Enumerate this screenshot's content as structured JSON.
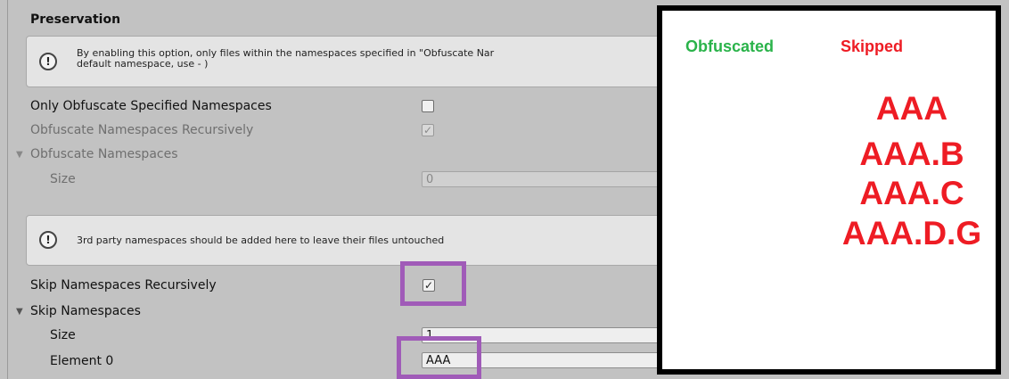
{
  "section_title": "Preservation",
  "help_top": {
    "line1": "By enabling this option, only files within the namespaces specified in \"Obfuscate Nar",
    "line2": "default namespace, use - )"
  },
  "only_obfuscate": {
    "label": "Only Obfuscate Specified Namespaces",
    "checked": false
  },
  "obfuscate_recursive": {
    "label": "Obfuscate Namespaces Recursively",
    "checked": true,
    "check_glyph": "✓"
  },
  "obfuscate_namespaces": {
    "label": "Obfuscate Namespaces",
    "size_label": "Size",
    "size_value": "0"
  },
  "help_bottom": {
    "text": "3rd party namespaces should be added here to leave their files untouched"
  },
  "skip_recursive": {
    "label": "Skip Namespaces Recursively",
    "checked": true,
    "check_glyph": "✓"
  },
  "skip_namespaces": {
    "label": "Skip Namespaces",
    "size_label": "Size",
    "size_value": "1",
    "element_label": "Element 0",
    "element_value": "AAA"
  },
  "info_glyph": "!",
  "foldout_glyph": "▼",
  "legend": {
    "obfuscated": "Obfuscated",
    "skipped": "Skipped"
  },
  "skipped_list": [
    "AAA",
    "AAA.B",
    "AAA.C",
    "AAA.D.G"
  ],
  "colors": {
    "obfuscated": "#2ab34a",
    "skipped": "#ee1c24",
    "highlight": "#a05bb8"
  }
}
